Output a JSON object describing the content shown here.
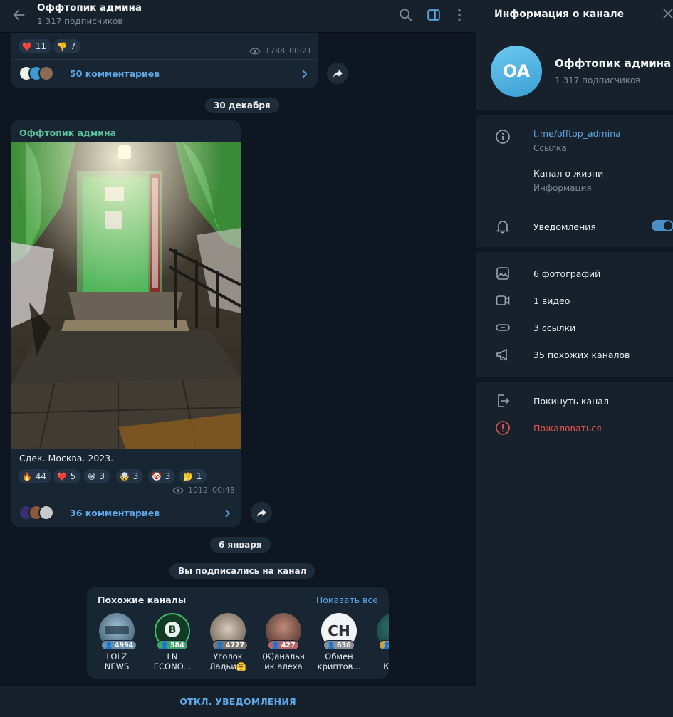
{
  "header": {
    "title": "Оффтопик админа",
    "subtitle": "1 317 подписчиков"
  },
  "messages": {
    "post1": {
      "reactions": [
        {
          "emoji": "❤️",
          "count": "11"
        },
        {
          "emoji": "👎",
          "count": "7"
        }
      ],
      "views": "1788",
      "time": "00:21",
      "comments": "50 комментариев"
    },
    "date1": "30 декабря",
    "post2": {
      "channel": "Оффтопик админа",
      "caption": "Сдек. Москва. 2023.",
      "reactions": [
        {
          "emoji": "🔥",
          "count": "44"
        },
        {
          "emoji": "❤️",
          "count": "5"
        },
        {
          "emoji": "😁",
          "count": "3"
        },
        {
          "emoji": "🤯",
          "count": "3"
        },
        {
          "emoji": "🤡",
          "count": "3"
        },
        {
          "emoji": "🤔",
          "count": "1"
        }
      ],
      "views": "1012",
      "time": "00:48",
      "comments": "36 комментариев"
    },
    "date2": "6 января",
    "service": "Вы подписались на канал"
  },
  "similar": {
    "title": "Похожие каналы",
    "show_all": "Показать все",
    "items": [
      {
        "name": "LOLZ\nNEWS",
        "count": "4994",
        "color": "#6a8fa8"
      },
      {
        "name": "LN\nECONO...",
        "count": "584",
        "color": "#3fa36a"
      },
      {
        "name": "Уголок\nЛадьи🤗",
        "count": "4727",
        "color": "#7a756c"
      },
      {
        "name": "(К)анальч\nик алеха",
        "count": "427",
        "color": "#b46466"
      },
      {
        "name": "Обмен\nкриптов...",
        "count": "636",
        "color": "#8a8f98"
      },
      {
        "name": "Фе\nКалы",
        "count": "",
        "color": "#c9a34a"
      }
    ]
  },
  "bottom_button": "ОТКЛ. УВЕДОМЛЕНИЯ",
  "info": {
    "title": "Информация о канале",
    "avatar_initials": "OA",
    "name": "Оффтопик админа",
    "subscribers": "1 317 подписчиков",
    "link": "t.me/offtop_admina",
    "link_label": "Ссылка",
    "description": "Канал о жизни",
    "description_label": "Информация",
    "notifications": "Уведомления",
    "notifications_on": true,
    "photos": "6 фотографий",
    "videos": "1 видео",
    "links": "3 ссылки",
    "similar_channels": "35 похожих каналов",
    "leave": "Покинуть канал",
    "report": "Пожаловаться"
  },
  "colors": {
    "accent": "#5ea8e8",
    "channel_name": "#5bbf9d",
    "danger": "#e5544e",
    "toggle": "#4c8fc5"
  }
}
